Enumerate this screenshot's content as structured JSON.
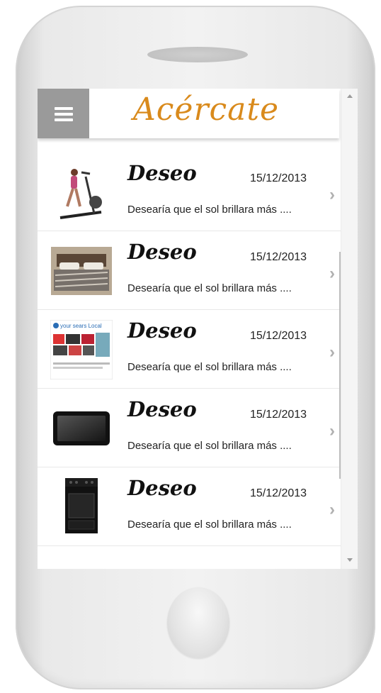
{
  "app": {
    "logo_text": "Acércate",
    "brand_color": "#d98a1c"
  },
  "header": {
    "menu_icon": "hamburger-menu-icon"
  },
  "list": {
    "items": [
      {
        "title": "Deseo",
        "date": "15/12/2013",
        "description": "Desearía que el sol brillara más ....",
        "image": "elliptical-machine"
      },
      {
        "title": "Deseo",
        "date": "15/12/2013",
        "description": "Desearía que el sol brillara más ....",
        "image": "bed"
      },
      {
        "title": "Deseo",
        "date": "15/12/2013",
        "description": "Desearía que el sol brillara más ....",
        "image": "sears-flyer",
        "image_text": "your sears Local"
      },
      {
        "title": "Deseo",
        "date": "15/12/2013",
        "description": "Desearía que el sol brillara más ....",
        "image": "tablet"
      },
      {
        "title": "Deseo",
        "date": "15/12/2013",
        "description": "Desearía que el sol brillara más ....",
        "image": "stove"
      }
    ]
  }
}
